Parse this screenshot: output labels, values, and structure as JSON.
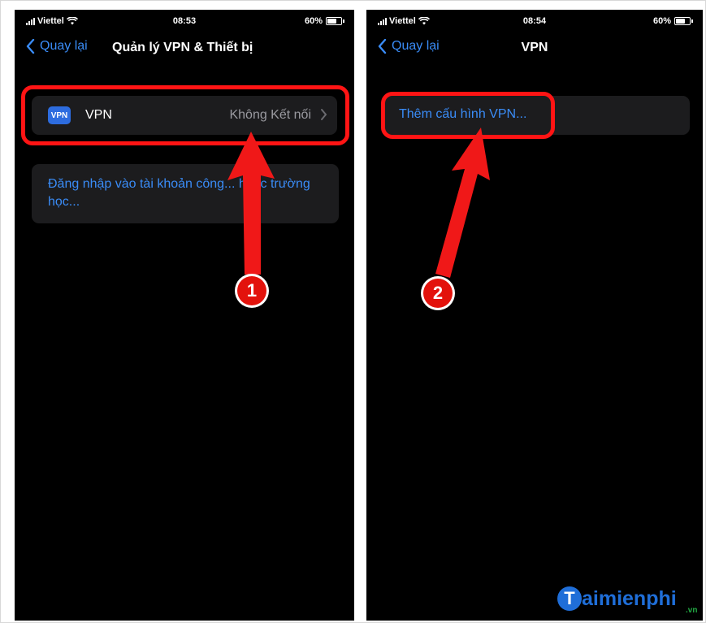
{
  "screen1": {
    "status": {
      "carrier": "Viettel",
      "time": "08:53",
      "battery": "60%",
      "battery_level": 0.6
    },
    "nav": {
      "back_label": "Quay lại",
      "title": "Quản lý VPN & Thiết bị"
    },
    "vpn_row": {
      "icon_text": "VPN",
      "label": "VPN",
      "status": "Không Kết nối"
    },
    "signin_row": {
      "label": "Đăng nhập vào tài khoản công... hoặc trường học..."
    },
    "callout_number": "1"
  },
  "screen2": {
    "status": {
      "carrier": "Viettel",
      "time": "08:54",
      "battery": "60%",
      "battery_level": 0.6
    },
    "nav": {
      "back_label": "Quay lại",
      "title": "VPN"
    },
    "add_row": {
      "label": "Thêm cấu hình VPN..."
    },
    "callout_number": "2"
  },
  "watermark": {
    "logo_letter": "T",
    "logo_text": "aimienphi",
    "logo_suffix": ".vn"
  },
  "colors": {
    "ios_blue": "#3a8cf7",
    "cell_bg": "#1c1c1e",
    "highlight_red": "#ff1414",
    "brand_blue": "#1f6ed8"
  }
}
